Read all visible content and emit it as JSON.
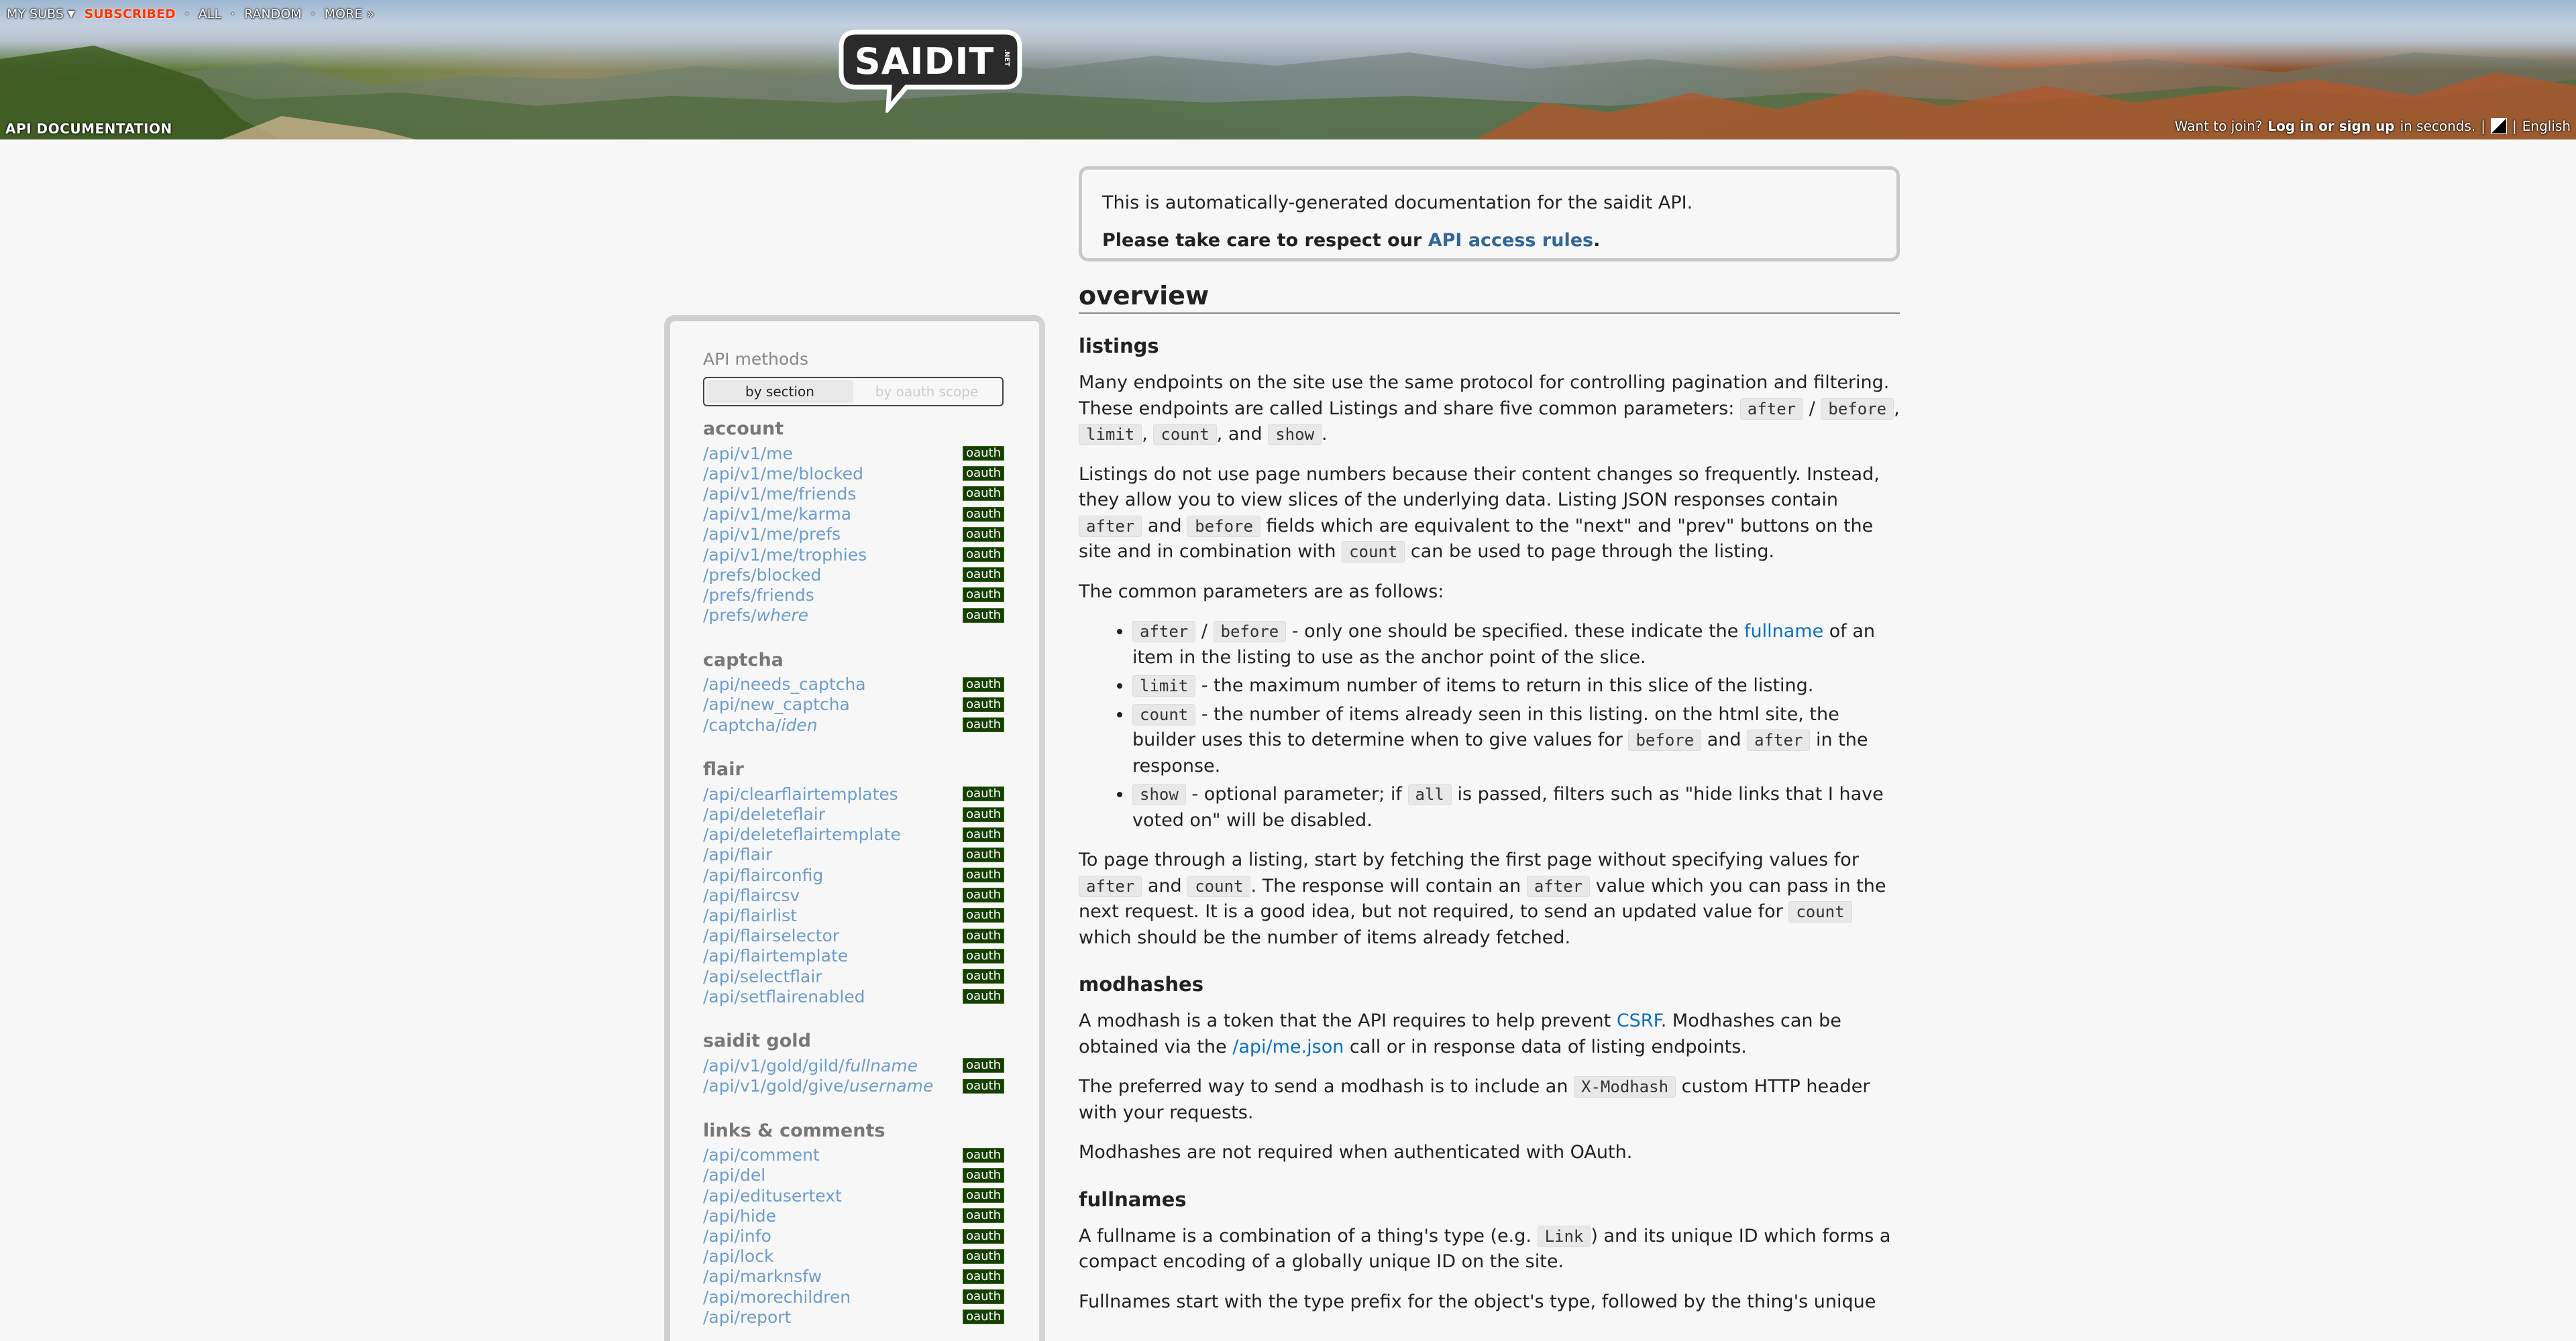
{
  "header": {
    "sr_bar": {
      "my_subs": "MY SUBS",
      "subscribed": "SUBSCRIBED",
      "all": "ALL",
      "random": "RANDOM",
      "more": "MORE »"
    },
    "logo_text": "SAIDIT",
    "logo_suffix": ".NET",
    "page_name": "API DOCUMENTATION",
    "right": {
      "join_text": "Want to join?",
      "login_text": "Log in or sign up",
      "seconds_text": "in seconds.",
      "language": "English"
    }
  },
  "notice": {
    "line1": "This is automatically-generated documentation for the saidit API.",
    "line2_prefix": "Please take care to respect our",
    "line2_link": "API access rules",
    "line2_suffix": "."
  },
  "sidebar": {
    "title": "API methods",
    "toggle": {
      "by_section": "by section",
      "by_scope": "by oauth scope"
    },
    "badge": "oauth",
    "sections": [
      {
        "title": "account",
        "items": [
          {
            "path": "/api/v1/me"
          },
          {
            "path": "/api/v1/me/blocked"
          },
          {
            "path": "/api/v1/me/friends"
          },
          {
            "path": "/api/v1/me/karma"
          },
          {
            "path": "/api/v1/me/prefs"
          },
          {
            "path": "/api/v1/me/trophies"
          },
          {
            "path": "/prefs/blocked"
          },
          {
            "path": "/prefs/friends"
          },
          {
            "path": "/prefs/",
            "ital": "where"
          }
        ]
      },
      {
        "title": "captcha",
        "items": [
          {
            "path": "/api/needs_captcha"
          },
          {
            "path": "/api/new_captcha"
          },
          {
            "path": "/captcha/",
            "ital": "iden"
          }
        ]
      },
      {
        "title": "flair",
        "items": [
          {
            "path": "/api/clearflairtemplates"
          },
          {
            "path": "/api/deleteflair"
          },
          {
            "path": "/api/deleteflairtemplate"
          },
          {
            "path": "/api/flair"
          },
          {
            "path": "/api/flairconfig"
          },
          {
            "path": "/api/flaircsv"
          },
          {
            "path": "/api/flairlist"
          },
          {
            "path": "/api/flairselector"
          },
          {
            "path": "/api/flairtemplate"
          },
          {
            "path": "/api/selectflair"
          },
          {
            "path": "/api/setflairenabled"
          }
        ]
      },
      {
        "title": "saidit gold",
        "items": [
          {
            "path": "/api/v1/gold/gild/",
            "ital": "fullname"
          },
          {
            "path": "/api/v1/gold/give/",
            "ital": "username"
          }
        ]
      },
      {
        "title": "links & comments",
        "items": [
          {
            "path": "/api/comment"
          },
          {
            "path": "/api/del"
          },
          {
            "path": "/api/editusertext"
          },
          {
            "path": "/api/hide"
          },
          {
            "path": "/api/info"
          },
          {
            "path": "/api/lock"
          },
          {
            "path": "/api/marknsfw"
          },
          {
            "path": "/api/morechildren"
          },
          {
            "path": "/api/report"
          }
        ]
      }
    ]
  },
  "main": {
    "overview_title": "overview",
    "listings": {
      "title": "listings",
      "p1": [
        "Many endpoints on the site use the same protocol for controlling pagination and filtering. These endpoints are called Listings and share five common parameters: ",
        {
          "code": "after"
        },
        " / ",
        {
          "code": "before"
        },
        ", ",
        {
          "code": "limit"
        },
        ", ",
        {
          "code": "count"
        },
        ", and ",
        {
          "code": "show"
        },
        "."
      ],
      "p2": [
        "Listings do not use page numbers because their content changes so frequently. Instead, they allow you to view slices of the underlying data. Listing JSON responses contain ",
        {
          "code": "after"
        },
        " and ",
        {
          "code": "before"
        },
        " fields which are equivalent to the \"next\" and \"prev\" buttons on the site and in combination with ",
        {
          "code": "count"
        },
        " can be used to page through the listing."
      ],
      "p3": [
        "The common parameters are as follows:"
      ],
      "bullets": [
        [
          {
            "code": "after"
          },
          " / ",
          {
            "code": "before"
          },
          " - only one should be specified. these indicate the ",
          {
            "link": "fullname"
          },
          " of an item in the listing to use as the anchor point of the slice."
        ],
        [
          {
            "code": "limit"
          },
          " - the maximum number of items to return in this slice of the listing."
        ],
        [
          {
            "code": "count"
          },
          " - the number of items already seen in this listing. on the html site, the builder uses this to determine when to give values for ",
          {
            "code": "before"
          },
          " and ",
          {
            "code": "after"
          },
          " in the response."
        ],
        [
          {
            "code": "show"
          },
          " - optional parameter; if ",
          {
            "code": "all"
          },
          " is passed, filters such as \"hide links that I have voted on\" will be disabled."
        ]
      ],
      "p4": [
        "To page through a listing, start by fetching the first page without specifying values for ",
        {
          "code": "after"
        },
        " and ",
        {
          "code": "count"
        },
        ". The response will contain an ",
        {
          "code": "after"
        },
        " value which you can pass in the next request. It is a good idea, but not required, to send an updated value for ",
        {
          "code": "count"
        },
        " which should be the number of items already fetched."
      ]
    },
    "modhashes": {
      "title": "modhashes",
      "p1": [
        "A modhash is a token that the API requires to help prevent ",
        {
          "link": "CSRF"
        },
        ". Modhashes can be obtained via the ",
        {
          "link": "/api/me.json"
        },
        " call or in response data of listing endpoints."
      ],
      "p2": [
        "The preferred way to send a modhash is to include an ",
        {
          "code": "X-Modhash"
        },
        " custom HTTP header with your requests."
      ],
      "p3": [
        "Modhashes are not required when authenticated with OAuth."
      ]
    },
    "fullnames": {
      "title": "fullnames",
      "p1": [
        "A fullname is a combination of a thing's type (e.g. ",
        {
          "code": "Link"
        },
        ") and its unique ID which forms a compact encoding of a globally unique ID on the site."
      ],
      "p2": [
        "Fullnames start with the type prefix for the object's type, followed by the thing's unique"
      ]
    }
  }
}
